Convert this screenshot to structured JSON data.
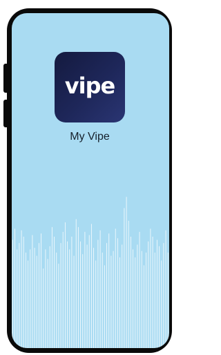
{
  "app": {
    "icon_text": "vipe",
    "name": "My Vipe"
  },
  "colors": {
    "screen_background": "#a9dbf2",
    "phone_frame": "#0a0a0a",
    "icon_background": "#1e275a",
    "waveform_bars": "#ffffff"
  },
  "waveform": {
    "bar_levels": [
      0.68,
      0.75,
      0.62,
      0.66,
      0.74,
      0.7,
      0.6,
      0.55,
      0.62,
      0.71,
      0.63,
      0.58,
      0.66,
      0.72,
      0.5,
      0.62,
      0.56,
      0.64,
      0.76,
      0.7,
      0.6,
      0.53,
      0.66,
      0.73,
      0.79,
      0.67,
      0.62,
      0.7,
      0.58,
      0.81,
      0.76,
      0.67,
      0.59,
      0.73,
      0.65,
      0.71,
      0.78,
      0.63,
      0.55,
      0.68,
      0.74,
      0.6,
      0.52,
      0.66,
      0.72,
      0.58,
      0.61,
      0.75,
      0.69,
      0.57,
      0.65,
      0.88,
      0.95,
      0.8,
      0.7,
      0.62,
      0.57,
      0.65,
      0.73,
      0.61,
      0.52,
      0.6,
      0.67,
      0.75,
      0.7,
      0.6,
      0.68,
      0.64,
      0.55,
      0.66,
      0.74,
      0.6
    ]
  }
}
